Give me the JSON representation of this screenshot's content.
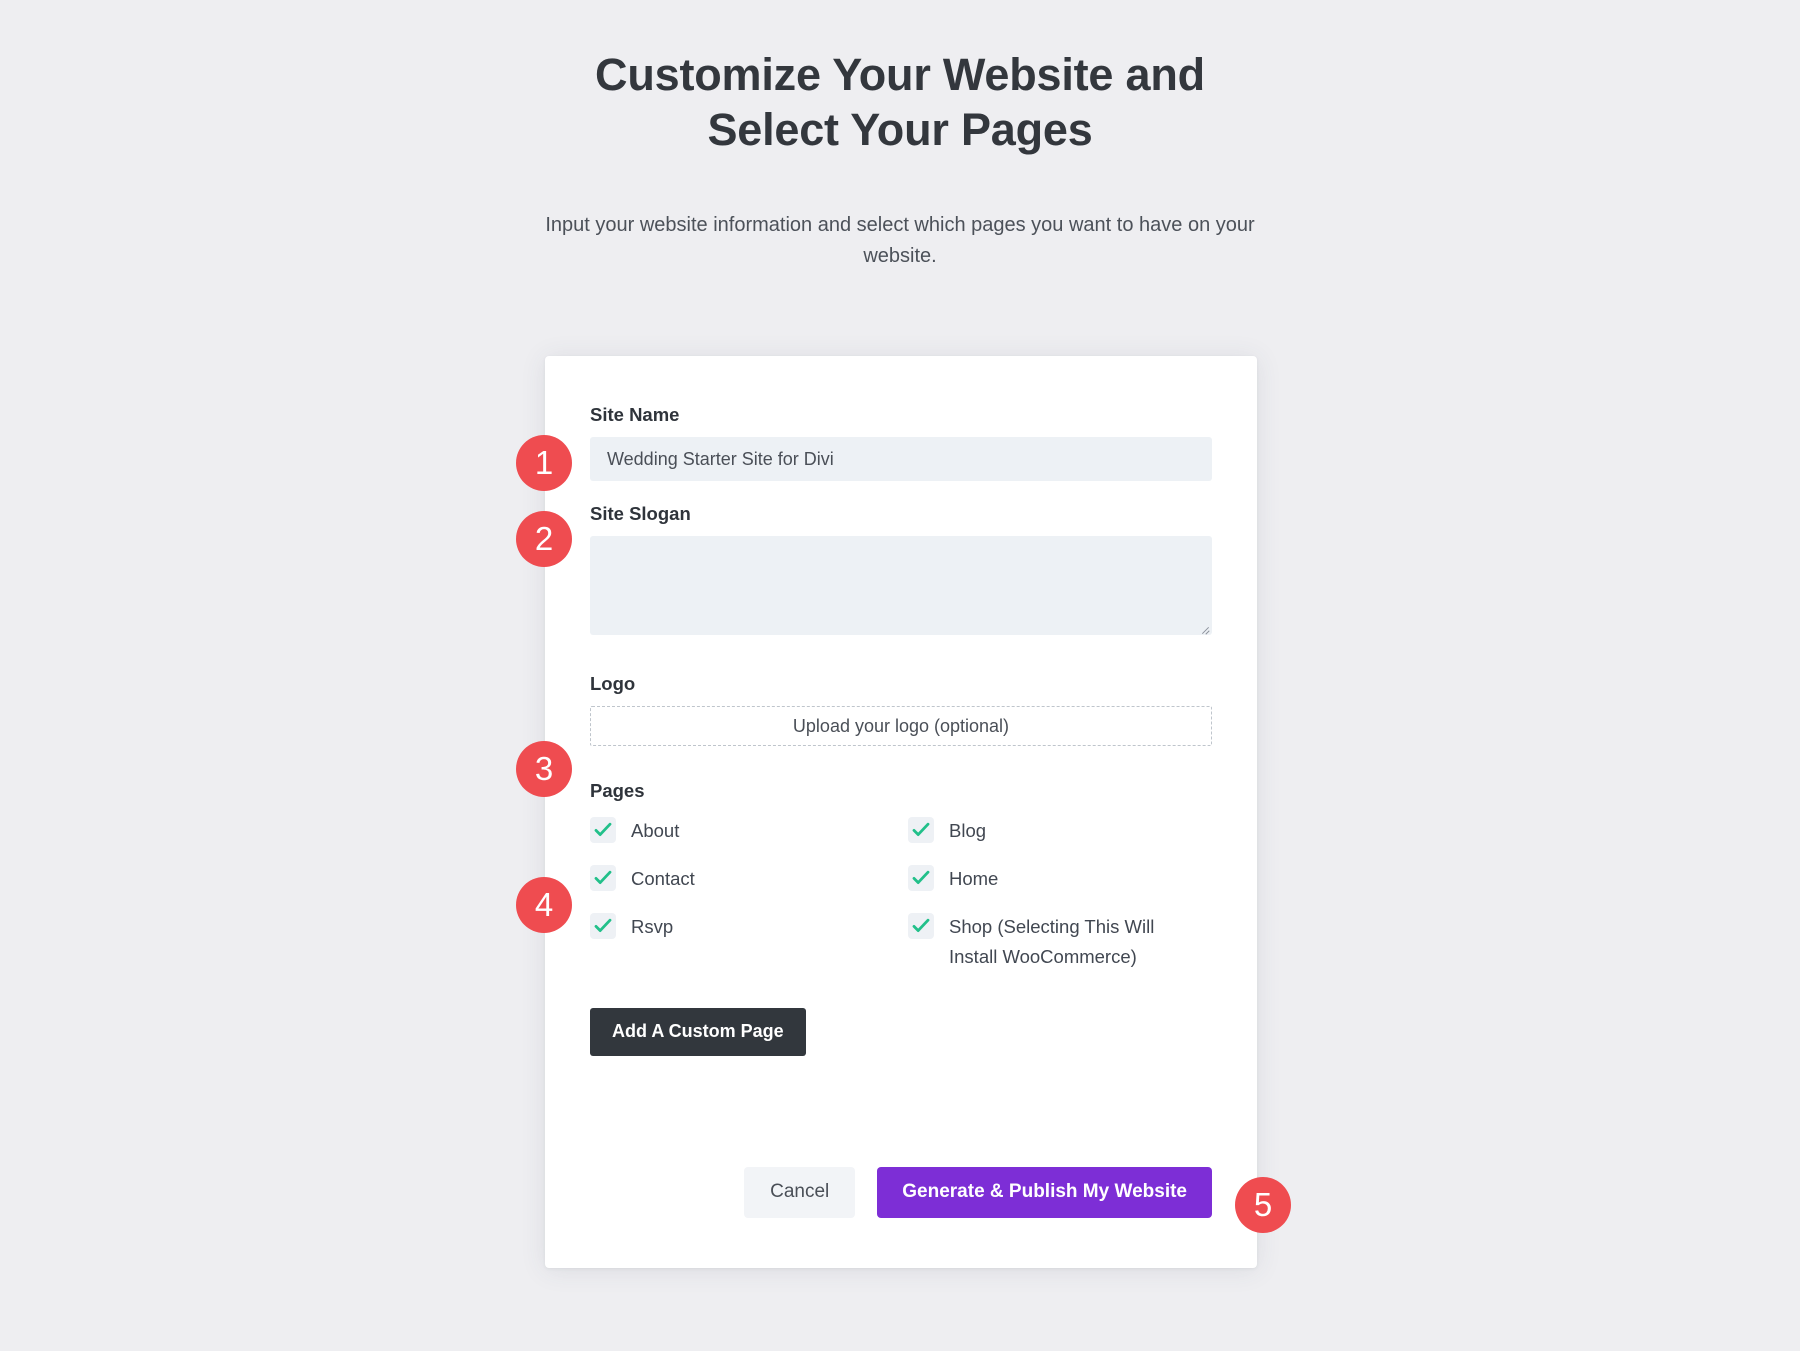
{
  "header": {
    "title": "Customize Your Website and Select Your Pages",
    "subtitle": "Input your website information and select which pages you want to have on your website."
  },
  "form": {
    "site_name": {
      "label": "Site Name",
      "value": "Wedding Starter Site for Divi",
      "placeholder": ""
    },
    "site_slogan": {
      "label": "Site Slogan",
      "value": "",
      "placeholder": ""
    },
    "logo": {
      "label": "Logo",
      "upload_text": "Upload your logo (optional)"
    },
    "pages": {
      "label": "Pages",
      "options": [
        {
          "label": "About",
          "checked": true
        },
        {
          "label": "Blog",
          "checked": true
        },
        {
          "label": "Contact",
          "checked": true
        },
        {
          "label": "Home",
          "checked": true
        },
        {
          "label": "Rsvp",
          "checked": true
        },
        {
          "label": "Shop (Selecting This Will Install WooCommerce)",
          "checked": true
        }
      ]
    },
    "add_custom_page_label": "Add A Custom Page"
  },
  "actions": {
    "cancel_label": "Cancel",
    "submit_label": "Generate & Publish My Website"
  },
  "badges": [
    {
      "number": "1"
    },
    {
      "number": "2"
    },
    {
      "number": "3"
    },
    {
      "number": "4"
    },
    {
      "number": "5"
    }
  ],
  "colors": {
    "badge_red": "#ef4c50",
    "primary_purple": "#7d2ed6",
    "dark_button": "#32373d",
    "check_green": "#22c08a",
    "input_background": "#edf1f5",
    "page_background": "#eeeef1"
  },
  "icons": {
    "check": "check-icon",
    "resize": "resize-handle-icon"
  }
}
